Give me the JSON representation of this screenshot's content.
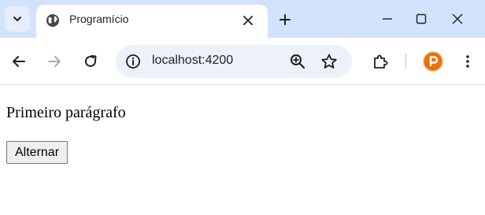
{
  "browser": {
    "tab": {
      "title": "Programício"
    },
    "omnibox": {
      "url": "localhost:4200"
    },
    "icons": {
      "tab_search": "chevron-down-icon",
      "favicon": "globe-icon",
      "tab_close": "close-icon",
      "new_tab": "plus-icon",
      "minimize": "minimize-icon",
      "maximize": "maximize-icon",
      "close_window": "close-icon",
      "back": "back-arrow-icon",
      "forward": "forward-arrow-icon",
      "reload": "reload-icon",
      "site_info": "info-icon",
      "zoom": "zoom-in-icon",
      "bookmark": "star-icon",
      "extensions": "puzzle-icon",
      "profile": "profile-avatar-icon",
      "menu": "more-vert-icon"
    },
    "colors": {
      "tabstrip": "#d3e3fd",
      "omnibox": "#edf2fa",
      "profile": "#e8710a"
    }
  },
  "page": {
    "paragraph": "Primeiro parágrafo",
    "toggle_button": "Alternar"
  }
}
